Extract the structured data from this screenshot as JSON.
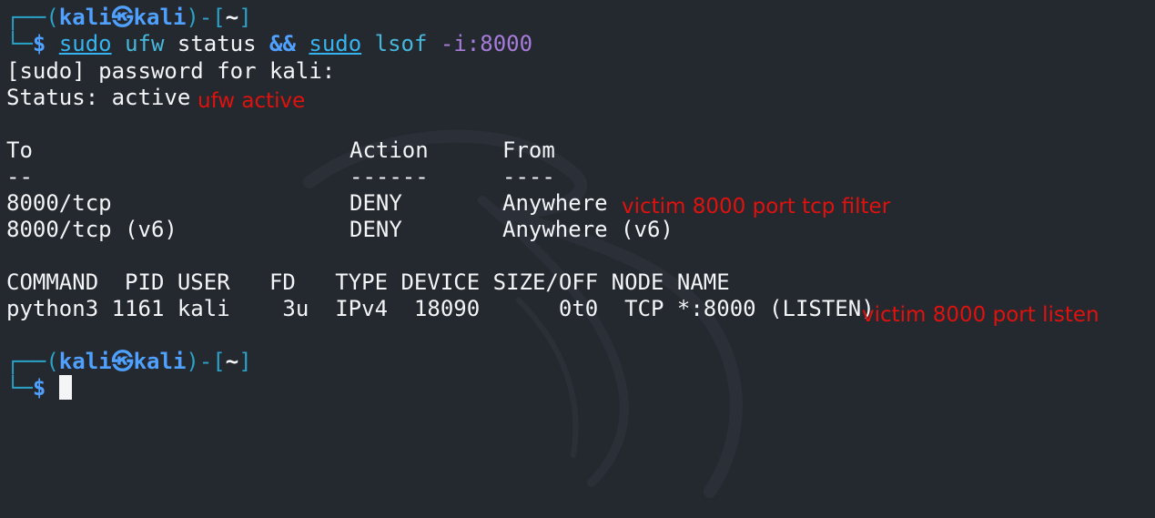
{
  "prompt1": {
    "corner_top": "┌──(",
    "user": "kali",
    "at": "㉿",
    "host": "kali",
    "mid": ")-[",
    "dir": "~",
    "end": "]",
    "corner_bottom": "└─",
    "dollar": "$"
  },
  "command": {
    "sudo1": "sudo",
    "ufw": "ufw",
    "args1": "status",
    "and": "&&",
    "sudo2": "sudo",
    "lsof": "lsof",
    "flag": "-i:8000"
  },
  "output": {
    "password_prompt": "[sudo] password for kali:",
    "status_line": "Status: active",
    "table_headers": {
      "to": "To",
      "action": "Action",
      "from": "From"
    },
    "table_dashes": {
      "to": "--",
      "action": "------",
      "from": "----"
    },
    "rules": [
      {
        "to": "8000/tcp",
        "action": "DENY",
        "from": "Anywhere"
      },
      {
        "to": "8000/tcp (v6)",
        "action": "DENY",
        "from": "Anywhere (v6)"
      }
    ],
    "lsof_header": "COMMAND  PID USER   FD   TYPE DEVICE SIZE/OFF NODE NAME",
    "lsof_row": "python3 1161 kali    3u  IPv4  18090      0t0  TCP *:8000 (LISTEN)"
  },
  "annotations": {
    "ufw_active": "ufw active",
    "tcp_filter": "victim 8000 port tcp filter",
    "listen": "victim 8000 port listen"
  },
  "prompt2": {
    "corner_top": "┌──(",
    "user": "kali",
    "at": "㉿",
    "host": "kali",
    "mid": ")-[",
    "dir": "~",
    "end": "]",
    "corner_bottom": "└─",
    "dollar": "$"
  },
  "colors": {
    "background": "#24282f",
    "prompt_blue": "#4fa0ff",
    "annotation_red": "#e0120e"
  }
}
